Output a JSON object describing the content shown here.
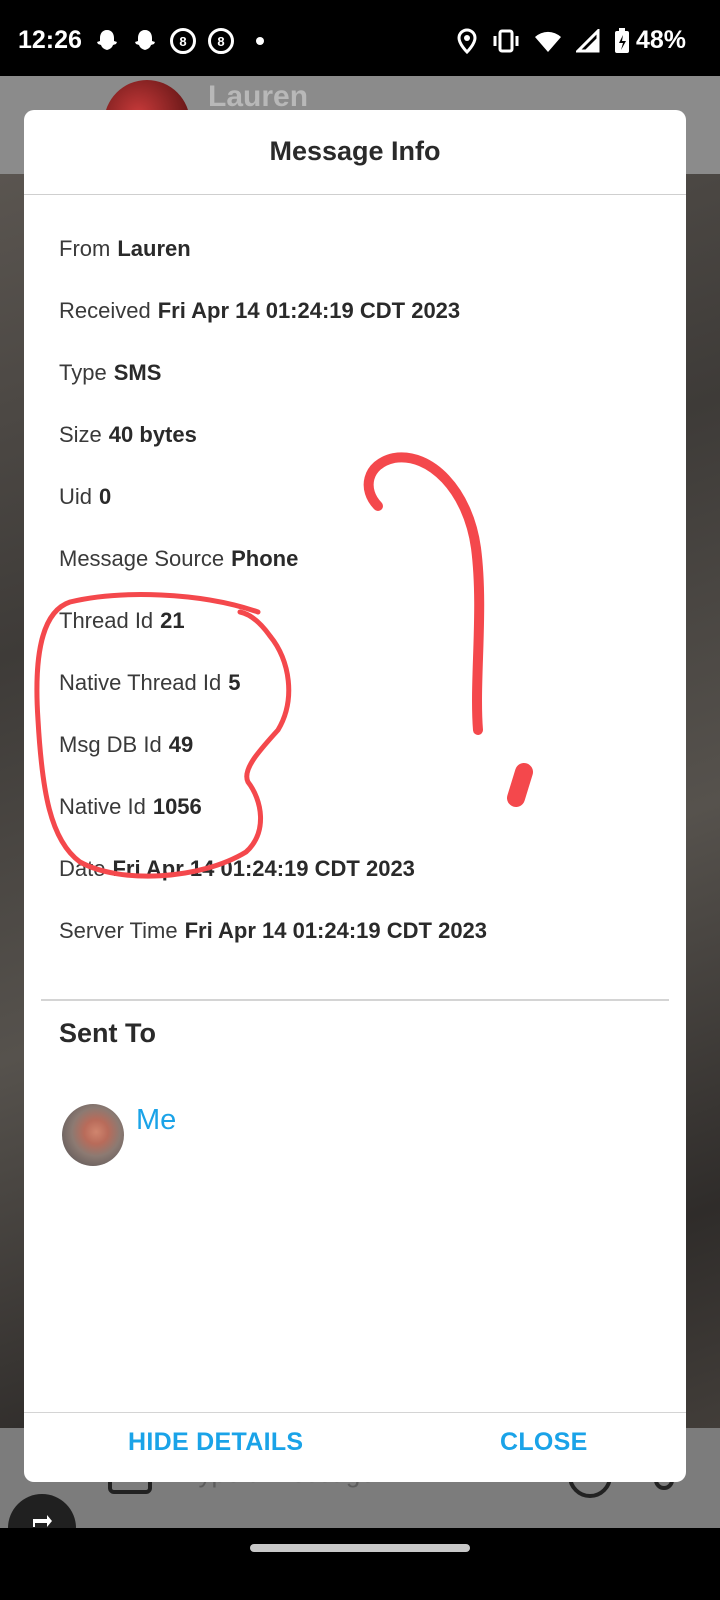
{
  "status_bar": {
    "time": "12:26",
    "battery": "48%",
    "left_icons": [
      "snapchat-icon",
      "snapchat-icon",
      "eight-ball-icon",
      "eight-ball-icon",
      "dot"
    ],
    "right_icons": [
      "location-icon",
      "vibrate-icon",
      "wifi-icon",
      "signal-icon",
      "battery-charging-icon"
    ]
  },
  "background_app": {
    "contact_name": "Lauren",
    "compose_placeholder": "Type a message..."
  },
  "dialog": {
    "title": "Message Info",
    "rows": [
      {
        "label": "From",
        "value": "Lauren"
      },
      {
        "label": "Received",
        "value": "Fri Apr 14 01:24:19 CDT 2023"
      },
      {
        "label": "Type",
        "value": "SMS"
      },
      {
        "label": "Size",
        "value": "40 bytes"
      },
      {
        "label": "Uid",
        "value": "0"
      },
      {
        "label": "Message Source",
        "value": "Phone"
      },
      {
        "label": "Thread Id",
        "value": "21"
      },
      {
        "label": "Native Thread Id",
        "value": "5"
      },
      {
        "label": "Msg DB Id",
        "value": "49"
      },
      {
        "label": "Native Id",
        "value": "1056"
      },
      {
        "label": "Date",
        "value": "Fri Apr 14 01:24:19 CDT 2023"
      },
      {
        "label": "Server Time",
        "value": "Fri Apr 14 01:24:19 CDT 2023"
      }
    ],
    "sent_to_title": "Sent To",
    "recipient_name": "Me",
    "hide_details_label": "HIDE DETAILS",
    "close_label": "CLOSE"
  },
  "colors": {
    "accent": "#1aa3e8",
    "annotation": "#f4484c"
  }
}
